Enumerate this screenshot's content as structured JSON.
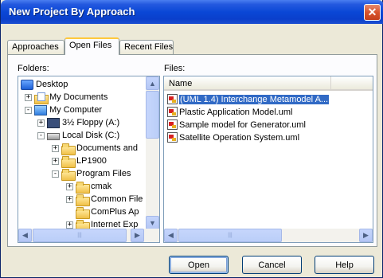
{
  "window": {
    "title": "New Project By Approach"
  },
  "tabs": [
    {
      "label": "Approaches"
    },
    {
      "label": "Open Files"
    },
    {
      "label": "Recent Files"
    }
  ],
  "folders": {
    "label": "Folders:",
    "items": [
      {
        "label": "Desktop",
        "icon": "desktop-icon",
        "expander": ""
      },
      {
        "label": "My Documents",
        "icon": "my-documents-icon",
        "expander": "+"
      },
      {
        "label": "My Computer",
        "icon": "my-computer-icon",
        "expander": "-"
      },
      {
        "label": "3½ Floppy (A:)",
        "icon": "floppy-icon",
        "expander": "+"
      },
      {
        "label": "Local Disk (C:)",
        "icon": "disk-icon",
        "expander": "-"
      },
      {
        "label": "Documents and",
        "icon": "folder-icon",
        "expander": "+"
      },
      {
        "label": "LP1900",
        "icon": "folder-icon",
        "expander": "+"
      },
      {
        "label": "Program Files",
        "icon": "folder-icon",
        "expander": "-"
      },
      {
        "label": "cmak",
        "icon": "folder-icon",
        "expander": "+"
      },
      {
        "label": "Common File",
        "icon": "folder-icon",
        "expander": "+"
      },
      {
        "label": "ComPlus Ap",
        "icon": "folder-icon",
        "expander": ""
      },
      {
        "label": "Internet Exp",
        "icon": "folder-icon",
        "expander": "+"
      }
    ]
  },
  "files": {
    "label": "Files:",
    "column_name": "Name",
    "items": [
      {
        "name": "(UML 1.4) Interchange Metamodel A...",
        "selected": true
      },
      {
        "name": "Plastic Application Model.uml",
        "selected": false
      },
      {
        "name": "Sample model for Generator.uml",
        "selected": false
      },
      {
        "name": "Satellite Operation System.uml",
        "selected": false
      }
    ]
  },
  "buttons": {
    "open": "Open",
    "cancel": "Cancel",
    "help": "Help"
  },
  "colors": {
    "titlebar": "#0a47d6",
    "dialog": "#ECE9D8",
    "selection": "#316ac5",
    "close": "#d8542d"
  }
}
